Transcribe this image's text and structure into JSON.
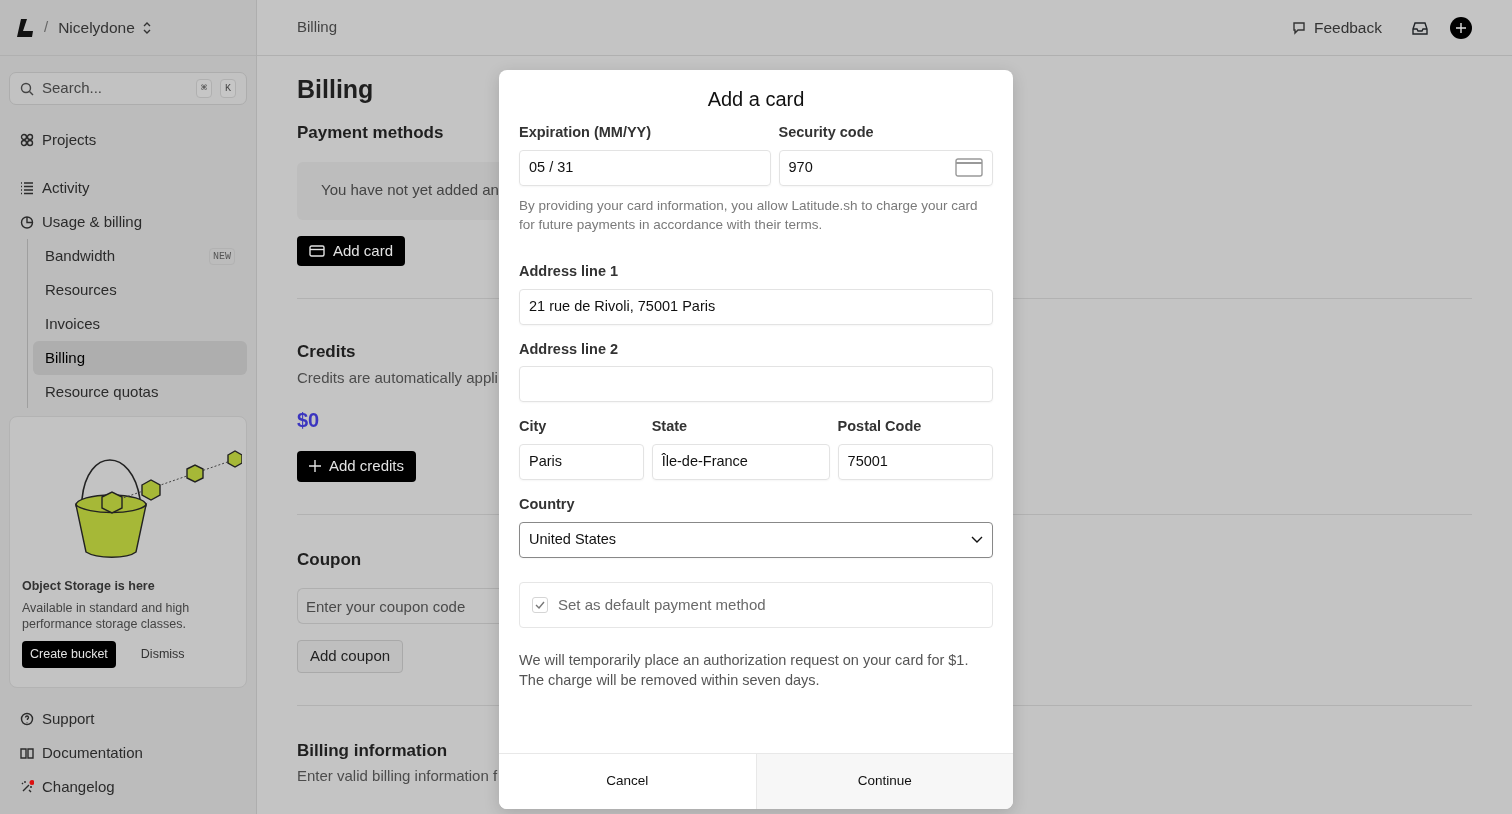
{
  "header": {
    "separator": "/",
    "org": "Nicelydone",
    "breadcrumb": "Billing",
    "feedback": "Feedback"
  },
  "sidebar": {
    "search": {
      "placeholder": "Search...",
      "keys": [
        "⌘",
        "K"
      ]
    },
    "items": [
      {
        "label": "Projects",
        "selected": false
      },
      {
        "label": "Activity",
        "selected": false
      },
      {
        "label": "Usage & billing",
        "selected": false,
        "children": [
          {
            "label": "Bandwidth",
            "selected": false,
            "badge": "NEW"
          },
          {
            "label": "Resources",
            "selected": false
          },
          {
            "label": "Invoices",
            "selected": false
          },
          {
            "label": "Billing",
            "selected": true
          },
          {
            "label": "Resource quotas",
            "selected": false
          }
        ]
      }
    ],
    "promo": {
      "title": "Object Storage is here",
      "text": "Available in standard and high performance storage classes.",
      "buttons": [
        {
          "label": "Create bucket",
          "kind": "primary"
        },
        {
          "label": "Dismiss",
          "kind": "link"
        }
      ]
    },
    "footer_items": [
      {
        "label": "Support"
      },
      {
        "label": "Documentation"
      },
      {
        "label": "Changelog"
      }
    ]
  },
  "page": {
    "title": "Billing",
    "sections": [
      {
        "title": "Payment methods",
        "empty": "You have not yet added an",
        "button": {
          "label": "Add card",
          "kind": "primary"
        }
      },
      {
        "title": "Credits",
        "text": "Credits are automatically appli",
        "amount": "$0",
        "button": {
          "label": "Add credits",
          "kind": "primary"
        }
      },
      {
        "title": "Coupon",
        "placeholder": "Enter your coupon code",
        "button": {
          "label": "Add coupon",
          "kind": "secondary"
        }
      },
      {
        "title": "Billing information",
        "text": "Enter valid billing information f"
      }
    ]
  },
  "modal": {
    "title": "Add a card",
    "rows": [
      [
        {
          "label": "Expiration (MM/YY)",
          "value": "05 / 31"
        },
        {
          "label": "Security code",
          "value": "970",
          "kind": "cvc"
        }
      ]
    ],
    "notice": "By providing your card information, you allow Latitude.sh to charge your card for future payments in accordance with their terms.",
    "address_rows": [
      [
        {
          "label": "Address line 1",
          "value": "21 rue de Rivoli, 75001 Paris"
        }
      ],
      [
        {
          "label": "Address line 2"
        }
      ],
      [
        {
          "label": "City",
          "value": "Paris"
        },
        {
          "label": "State",
          "value": "Île-de-France"
        },
        {
          "label": "Postal Code",
          "value": "75001"
        }
      ],
      [
        {
          "label": "Country",
          "value": "United States",
          "kind": "select"
        }
      ]
    ],
    "default_checkbox": {
      "label": "Set as default payment method",
      "checked": true
    },
    "note": "We will temporarily place an authorization request on your card for $1. The charge will be removed within seven days.",
    "buttons": [
      {
        "label": "Cancel",
        "kind": "secondary"
      },
      {
        "label": "Continue",
        "kind": "primary"
      }
    ]
  }
}
